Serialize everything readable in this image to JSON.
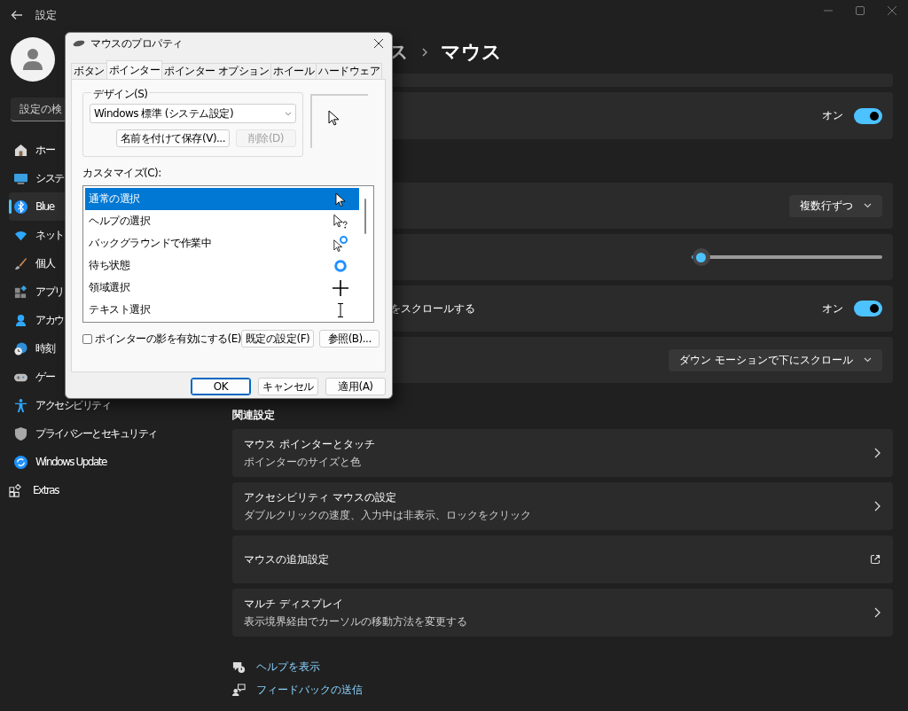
{
  "settings": {
    "title": "設定",
    "search": {
      "placeholder": "設定の検"
    },
    "nav": [
      {
        "label": "ホー",
        "kind": "page",
        "selected": false
      },
      {
        "label": "システ",
        "kind": "page",
        "selected": false
      },
      {
        "label": "Blue",
        "kind": "page",
        "selected": true
      },
      {
        "label": "ネット",
        "kind": "page",
        "selected": false
      },
      {
        "label": "個人",
        "kind": "page",
        "selected": false
      },
      {
        "label": "アプリ",
        "kind": "page",
        "selected": false
      },
      {
        "label": "アカウ",
        "kind": "page",
        "selected": false
      },
      {
        "label": "時刻",
        "kind": "page",
        "selected": false
      },
      {
        "label": "ゲー",
        "kind": "page",
        "selected": false
      },
      {
        "label": "アクセシビリティ",
        "kind": "page",
        "selected": false
      },
      {
        "label": "プライバシーとセキュリティ",
        "kind": "page",
        "selected": false
      },
      {
        "label": "Windows Update",
        "kind": "page",
        "selected": false
      },
      {
        "label": "Extras",
        "kind": "extra",
        "selected": false
      }
    ],
    "breadcrumb": {
      "parent": "ス",
      "current": "マウス"
    },
    "groups": [
      [
        {
          "kind": "blank"
        },
        {
          "kind": "toggle",
          "state_label": "オン",
          "on": true
        }
      ],
      [
        {
          "kind": "dropdown",
          "value": "複数行ずつ"
        },
        {
          "kind": "slider",
          "level": 0.05
        },
        {
          "kind": "toggle",
          "label": "をスクロールする",
          "state_label": "オン",
          "on": true
        },
        {
          "kind": "dropdown",
          "value": "ダウン モーションで下にスクロール"
        }
      ]
    ],
    "related": {
      "heading": "関連設定",
      "items": [
        {
          "title": "マウス ポインターとタッチ",
          "subtitle": "ポインターのサイズと色",
          "kind": "chevron"
        },
        {
          "title": "アクセシビリティ マウスの設定",
          "subtitle": "ダブルクリックの速度、入力中は非表示、ロックをクリック",
          "kind": "chevron"
        },
        {
          "title": "マウスの追加設定",
          "kind": "external"
        },
        {
          "title": "マルチ ディスプレイ",
          "subtitle": "表示境界経由でカーソルの移動方法を変更する",
          "kind": "chevron"
        }
      ]
    },
    "links": [
      {
        "label": "ヘルプを表示"
      },
      {
        "label": "フィードバックの送信"
      }
    ]
  },
  "dialog": {
    "title": "マウスのプロパティ",
    "tabs": [
      {
        "label": "ボタン",
        "selected": false
      },
      {
        "label": "ポインター",
        "selected": true
      },
      {
        "label": "ポインター オプション",
        "selected": false
      },
      {
        "label": "ホイール",
        "selected": false
      },
      {
        "label": "ハードウェア",
        "selected": false
      }
    ],
    "design": {
      "label": "デザイン(S)",
      "scheme": "Windows 標準 (システム設定)",
      "save_button": {
        "label": "名前を付けて保存(V)...",
        "disabled": false
      },
      "delete_button": {
        "label": "削除(D)",
        "disabled": true
      }
    },
    "customize_label": "カスタマイズ(C):",
    "pointers": [
      {
        "label": "通常の選択",
        "kind": "arrow",
        "selected": true
      },
      {
        "label": "ヘルプの選択",
        "kind": "help",
        "selected": false
      },
      {
        "label": "バックグラウンドで作業中",
        "kind": "working",
        "selected": false
      },
      {
        "label": "待ち状態",
        "kind": "busy",
        "selected": false
      },
      {
        "label": "領域選択",
        "kind": "cross",
        "selected": false
      },
      {
        "label": "テキスト選択",
        "kind": "text",
        "selected": false
      }
    ],
    "shadow": {
      "label": "ポインターの影を有効にする(E)",
      "checked": false
    },
    "side_buttons": [
      {
        "label": "既定の設定(F)"
      },
      {
        "label": "参照(B)..."
      }
    ],
    "footer_buttons": [
      {
        "label": "OK",
        "default": true
      },
      {
        "label": "キャンセル",
        "default": false
      },
      {
        "label": "適用(A)",
        "default": false
      }
    ]
  }
}
